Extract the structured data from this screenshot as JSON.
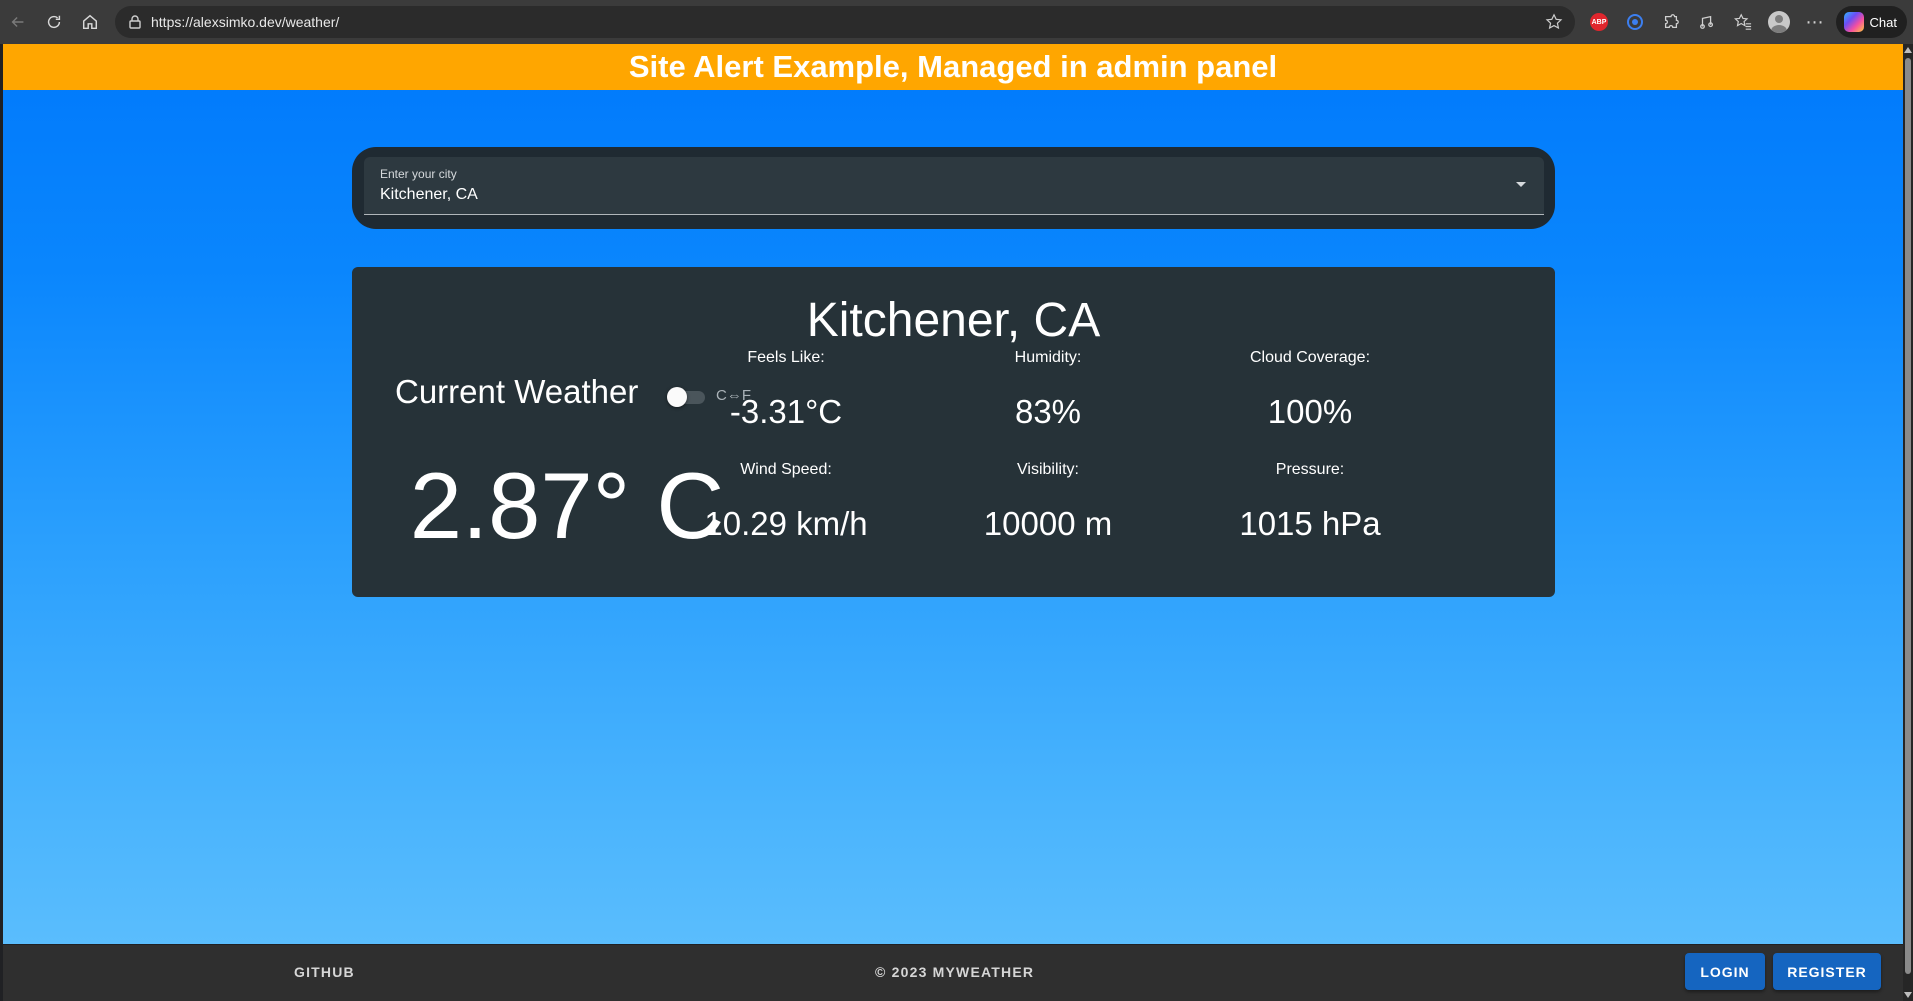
{
  "browser": {
    "url": "https://alexsimko.dev/weather/",
    "chat_label": "Chat",
    "abp_badge": "ABP"
  },
  "alert": {
    "text": "Site Alert Example, Managed in admin panel",
    "color": "#ffa600"
  },
  "search": {
    "label": "Enter your city",
    "value": "Kitchener, CA"
  },
  "weather": {
    "city": "Kitchener, CA",
    "current_label": "Current Weather",
    "unit_toggle_label": "C⇔F",
    "unit_toggle_on": false,
    "temperature": "2.87° C",
    "stats": [
      {
        "label": "Feels Like:",
        "value": "-3.31°C"
      },
      {
        "label": "Humidity:",
        "value": "83%"
      },
      {
        "label": "Cloud Coverage:",
        "value": "100%"
      },
      {
        "label": "Wind Speed:",
        "value": "10.29 km/h"
      },
      {
        "label": "Visibility:",
        "value": "10000 m"
      },
      {
        "label": "Pressure:",
        "value": "1015 hPa"
      }
    ]
  },
  "footer": {
    "github": "GITHUB",
    "copyright": "© 2023 MYWEATHER",
    "login": "LOGIN",
    "register": "REGISTER"
  },
  "colors": {
    "card_bg": "#263238",
    "button_bg": "#1565c0",
    "sky_top": "#0079fb",
    "sky_bottom": "#5abdfd"
  }
}
